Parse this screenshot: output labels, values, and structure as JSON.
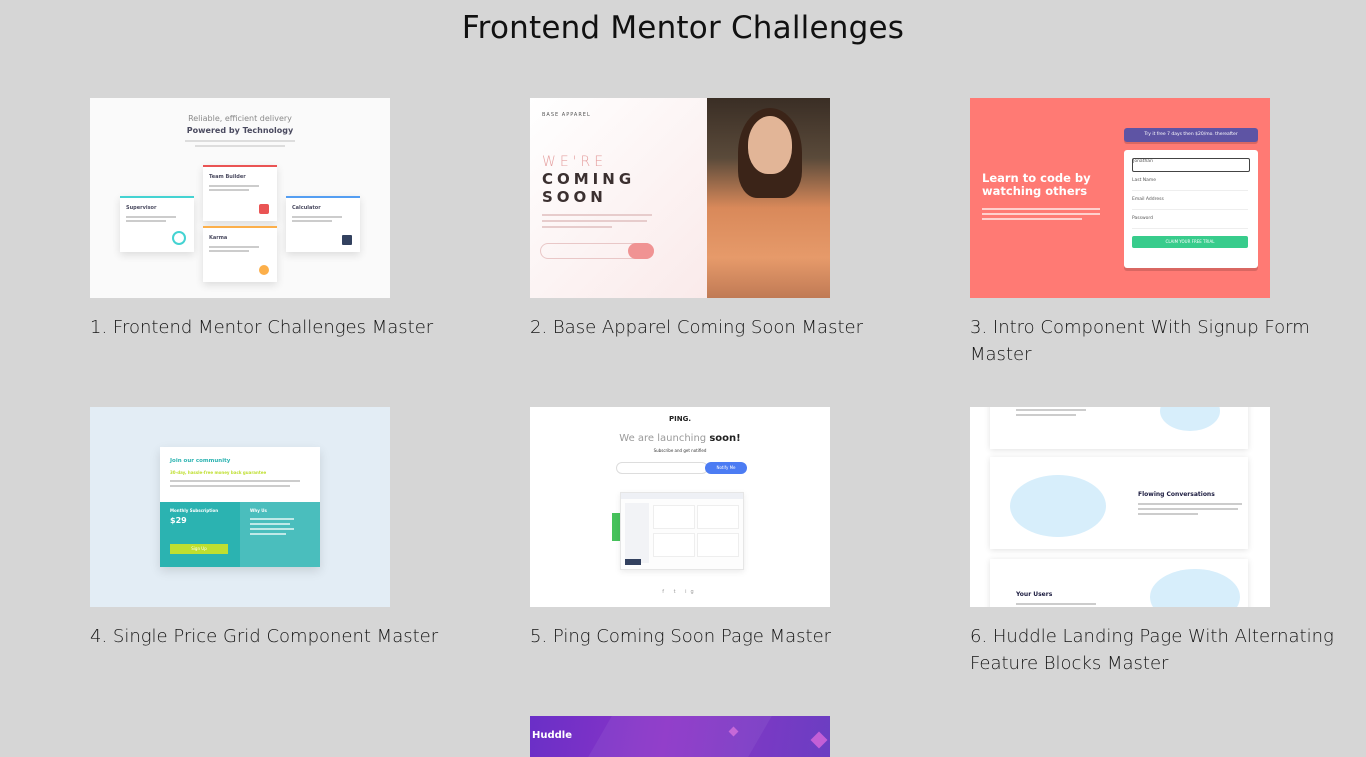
{
  "page": {
    "title": "Frontend Mentor Challenges"
  },
  "projects": [
    {
      "caption": "1. Frontend Mentor Challenges Master",
      "preview": {
        "line1": "Reliable, efficient delivery",
        "line2": "Powered by Technology",
        "cards": [
          "Supervisor",
          "Team Builder",
          "Karma",
          "Calculator"
        ]
      }
    },
    {
      "caption": "2. Base Apparel Coming Soon Master",
      "preview": {
        "logo": "BASE APPAREL",
        "line1": "WE'RE",
        "line2": "COMING",
        "line3": "SOON"
      }
    },
    {
      "caption": "3. Intro Component With Signup Form Master",
      "preview": {
        "hero": "Learn to code by watching others",
        "banner": "Try it free 7 days then $20/mo. thereafter",
        "fields": [
          "Jonathan",
          "Last Name",
          "Email Address",
          "Password"
        ],
        "cta": "CLAIM YOUR FREE TRIAL"
      }
    },
    {
      "caption": "4. Single Price Grid Component Master",
      "preview": {
        "title": "Join our community",
        "tagline": "30-day, hassle-free money back guarantee",
        "left_title": "Monthly Subscription",
        "price": "$29",
        "right_title": "Why Us",
        "button": "Sign Up"
      }
    },
    {
      "caption": "5. Ping Coming Soon Page Master",
      "preview": {
        "logo": "PING.",
        "headline_a": "We are launching ",
        "headline_b": "soon!",
        "sub": "Subscribe and get notified",
        "button": "Notify Me",
        "social": "f  t  ig"
      }
    },
    {
      "caption": "6. Huddle Landing Page With Alternating Feature Blocks Master",
      "preview": {
        "block1": "Flowing Conversations",
        "block2": "Your Users"
      }
    },
    {
      "caption": "",
      "preview": {
        "logo": "Huddle"
      }
    }
  ]
}
